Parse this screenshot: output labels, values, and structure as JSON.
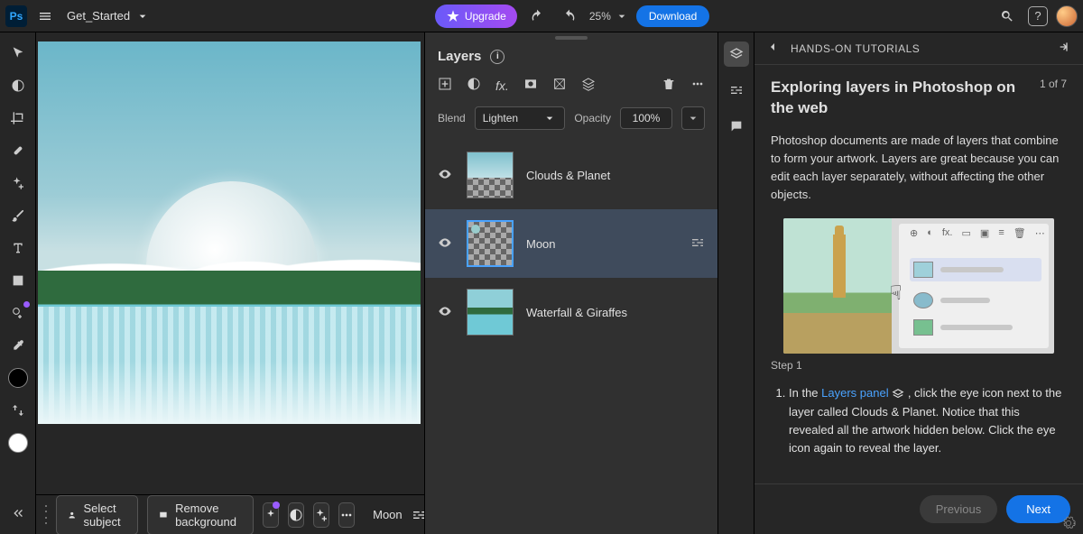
{
  "header": {
    "file_name": "Get_Started",
    "upgrade_label": "Upgrade",
    "zoom": "25%",
    "download_label": "Download"
  },
  "context_bar": {
    "select_subject": "Select subject",
    "remove_bg": "Remove background",
    "active_layer": "Moon"
  },
  "layers_panel": {
    "title": "Layers",
    "blend_label": "Blend",
    "blend_mode": "Lighten",
    "opacity_label": "Opacity",
    "opacity_value": "100%",
    "layers": [
      {
        "name": "Clouds & Planet"
      },
      {
        "name": "Moon"
      },
      {
        "name": "Waterfall & Giraffes"
      }
    ]
  },
  "tutorial": {
    "breadcrumb": "HANDS-ON TUTORIALS",
    "title": "Exploring layers in Photoshop on the web",
    "progress": "1 of 7",
    "description": "Photoshop documents are made of layers that combine to form your artwork. Layers are great because you can edit each layer separately, without affecting the other objects.",
    "step_label": "Step 1",
    "step_prefix": "In the ",
    "step_link": "Layers panel",
    "step_suffix": " , click the eye icon next to the layer called Clouds & Planet. Notice that this revealed all the artwork hidden below. Click the eye icon again to reveal the layer.",
    "prev": "Previous",
    "next": "Next"
  }
}
